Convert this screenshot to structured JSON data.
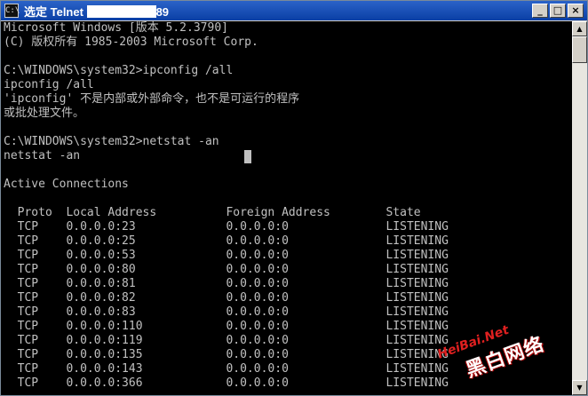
{
  "window": {
    "title": "选定 Telnet",
    "title_suffix": "89",
    "system_icon": "C:\\",
    "buttons": {
      "minimize": "_",
      "maximize": "□",
      "close": "×"
    }
  },
  "console": {
    "lines": [
      "Microsoft Windows [版本 5.2.3790]",
      "(C) 版权所有 1985-2003 Microsoft Corp.",
      "",
      "C:\\WINDOWS\\system32>ipconfig /all",
      "ipconfig /all",
      "'ipconfig' 不是内部或外部命令，也不是可运行的程序",
      "或批处理文件。",
      "",
      "C:\\WINDOWS\\system32>netstat -an",
      "netstat -an",
      "",
      "Active Connections",
      "",
      "  Proto  Local Address          Foreign Address        State",
      "  TCP    0.0.0.0:23             0.0.0.0:0              LISTENING",
      "  TCP    0.0.0.0:25             0.0.0.0:0              LISTENING",
      "  TCP    0.0.0.0:53             0.0.0.0:0              LISTENING",
      "  TCP    0.0.0.0:80             0.0.0.0:0              LISTENING",
      "  TCP    0.0.0.0:81             0.0.0.0:0              LISTENING",
      "  TCP    0.0.0.0:82             0.0.0.0:0              LISTENING",
      "  TCP    0.0.0.0:83             0.0.0.0:0              LISTENING",
      "  TCP    0.0.0.0:110            0.0.0.0:0              LISTENING",
      "  TCP    0.0.0.0:119            0.0.0.0:0              LISTENING",
      "  TCP    0.0.0.0:135            0.0.0.0:0              LISTENING",
      "  TCP    0.0.0.0:143            0.0.0.0:0              LISTENING",
      "  TCP    0.0.0.0:366            0.0.0.0:0              LISTENING"
    ]
  },
  "scrollbar": {
    "up": "▲",
    "down": "▼"
  },
  "watermark": {
    "cn": "黑白网络",
    "en": "HeiBai.Net"
  }
}
